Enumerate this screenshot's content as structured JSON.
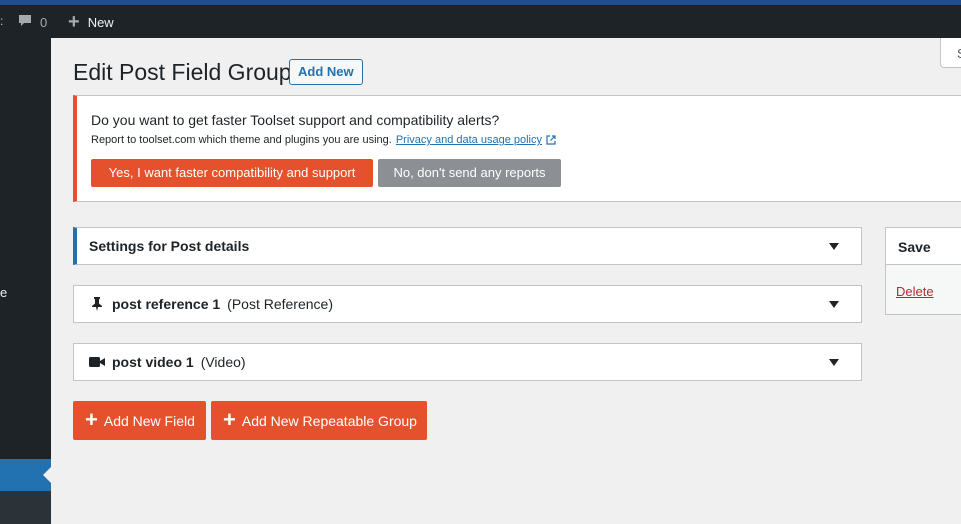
{
  "admin_bar": {
    "cut_left": ":",
    "comments_count": "0",
    "new_label": "New"
  },
  "sidebar": {
    "cut_label": "e"
  },
  "screen_options": {
    "cut_label": "S"
  },
  "header": {
    "title": "Edit Post Field Group",
    "add_new_label": "Add New"
  },
  "notice": {
    "title": "Do you want to get faster Toolset support and compatibility alerts?",
    "subtitle": "Report to toolset.com which theme and plugins you are using.",
    "policy_link": "Privacy and data usage policy",
    "yes_label": "Yes, I want faster compatibility and support",
    "no_label": "No, don't send any reports"
  },
  "panels": {
    "settings": {
      "title": "Settings for Post details"
    },
    "fields": [
      {
        "name": "post reference 1",
        "type": "(Post Reference)",
        "icon": "pin-icon"
      },
      {
        "name": "post video 1",
        "type": "(Video)",
        "icon": "video-camera-icon"
      }
    ]
  },
  "savebox": {
    "title": "Save",
    "delete_label": "Delete"
  },
  "actions": {
    "add_field_label": "Add New Field",
    "add_group_label": "Add New Repeatable Group"
  },
  "colors": {
    "accent_orange": "#e5512d",
    "wp_blue": "#2271b1",
    "admin_dark": "#1d2327",
    "delete_red": "#b32d2e"
  }
}
